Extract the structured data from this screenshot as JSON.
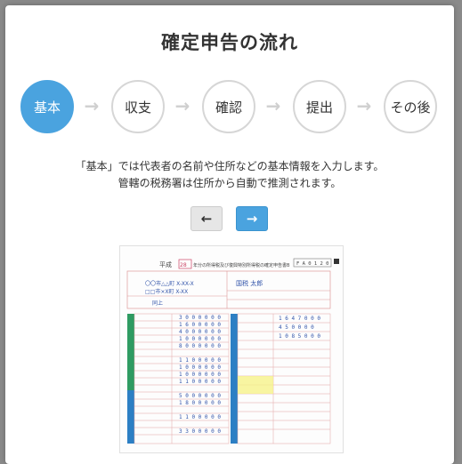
{
  "modal": {
    "title": "確定申告の流れ",
    "steps": [
      {
        "label": "基本",
        "active": true
      },
      {
        "label": "収支",
        "active": false
      },
      {
        "label": "確認",
        "active": false
      },
      {
        "label": "提出",
        "active": false
      },
      {
        "label": "その後",
        "active": false
      }
    ],
    "description_line1": "「基本」では代表者の名前や住所などの基本情報を入力します。",
    "description_line2": "管轄の税務署は住所から自動で推測されます。",
    "nav": {
      "prev_icon": "arrow-left-icon",
      "next_icon": "arrow-right-icon"
    },
    "form_image": {
      "header_year": "平成",
      "header_year_num": "28",
      "header_text": "年分の所得税及び復興特別所得税の確定申告書B",
      "form_code": "F A 0 1 2 0",
      "name": "国税 太郎",
      "address1": "〇〇市△△町 X-XX-X",
      "address2": "□□市×X町 X-XX",
      "address3": "同上"
    },
    "colors": {
      "accent": "#4aa3df",
      "step_border": "#d6d6d6",
      "green_band": "#2e9b62",
      "blue_band": "#2c7fc4"
    }
  }
}
